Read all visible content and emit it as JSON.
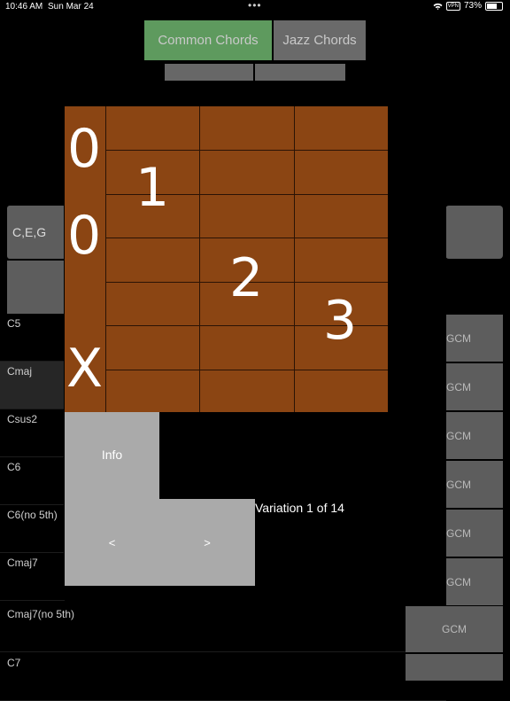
{
  "status_bar": {
    "time": "10:46 AM",
    "date": "Sun Mar 24",
    "dots": "•••",
    "vpn": "VPN",
    "battery": "73%"
  },
  "tabs": [
    {
      "label": "Common Chords",
      "selected": true
    },
    {
      "label": "Jazz Chords",
      "selected": false
    }
  ],
  "side": {
    "notes": "C,E,G"
  },
  "chords": [
    "C5",
    "Cmaj",
    "Csus2",
    "C6",
    "C6(no 5th)",
    "Cmaj7",
    "Cmaj7(no 5th)",
    "C7"
  ],
  "right_items": [
    "GCM",
    "GCM",
    "GCM",
    "GCM",
    "GCM",
    "GCM",
    "GCM"
  ],
  "fretboard": {
    "strings_open": [
      "0",
      "0",
      "X"
    ],
    "fingers": [
      "1",
      "2",
      "3"
    ]
  },
  "panel": {
    "info": "Info",
    "prev": "<",
    "next": ">",
    "variation": "Variation 1 of 14"
  },
  "colors": {
    "tab_selected": "#5e9a5e",
    "button": "#5d5d5d",
    "fretboard": "#8b4513",
    "panel": "#aaaaaa"
  }
}
